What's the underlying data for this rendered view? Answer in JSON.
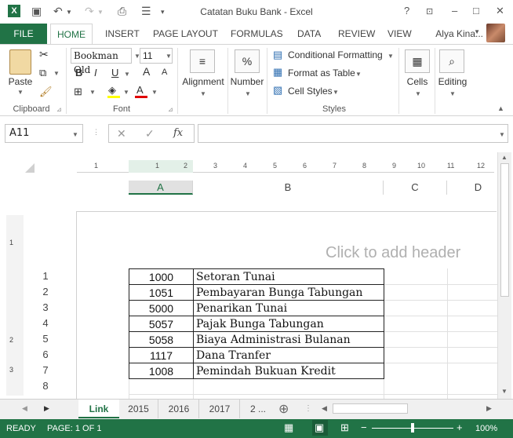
{
  "app": {
    "title": "Catatan Buku Bank - Excel",
    "brand_color": "#217346"
  },
  "window": {
    "help": "?",
    "minimize": "–",
    "maximize": "□",
    "close": "✕"
  },
  "quick_access": {
    "icons": [
      "excel-icon",
      "save-icon",
      "undo-icon",
      "redo-icon",
      "print-preview-icon",
      "customize-icon"
    ]
  },
  "ribbon_tabs": [
    "FILE",
    "HOME",
    "INSERT",
    "PAGE LAYOUT",
    "FORMULAS",
    "DATA",
    "REVIEW",
    "VIEW"
  ],
  "user": {
    "name": "Alya Kina..."
  },
  "ribbon": {
    "clipboard": {
      "paste": "Paste",
      "label": "Clipboard"
    },
    "font": {
      "name": "Bookman Old",
      "size": "11",
      "label": "Font",
      "bold": "B",
      "italic": "I",
      "underline": "U",
      "grow": "A",
      "shrink": "A"
    },
    "alignment": {
      "label": "Alignment",
      "icon": "≡"
    },
    "number": {
      "label": "Number",
      "icon": "%"
    },
    "styles": {
      "label": "Styles",
      "conditional": "Conditional Formatting",
      "format_table": "Format as Table",
      "cell_styles": "Cell Styles"
    },
    "cells": {
      "label": "Cells"
    },
    "editing": {
      "label": "Editing"
    }
  },
  "formula_bar": {
    "name_box": "A11",
    "cancel": "✕",
    "enter": "✓",
    "fx": "fx",
    "value": ""
  },
  "sheet": {
    "columns": [
      "A",
      "B",
      "C",
      "D"
    ],
    "header_hint": "Click to add header",
    "ruler_top": [
      "1",
      "1",
      "2",
      "3",
      "4",
      "5",
      "6",
      "7",
      "8",
      "9",
      "10",
      "11",
      "12"
    ],
    "ruler_left": [
      "1",
      "2",
      "3"
    ],
    "row_numbers": [
      "1",
      "2",
      "3",
      "4",
      "5",
      "6",
      "7",
      "8"
    ],
    "rows": [
      {
        "code": "1000",
        "desc": "Setoran Tunai"
      },
      {
        "code": "1051",
        "desc": "Pembayaran Bunga Tabungan"
      },
      {
        "code": "5000",
        "desc": "Penarikan Tunai"
      },
      {
        "code": "5057",
        "desc": "Pajak Bunga Tabungan"
      },
      {
        "code": "5058",
        "desc": "Biaya Administrasi Bulanan"
      },
      {
        "code": "1117",
        "desc": "Dana Tranfer"
      },
      {
        "code": "1008",
        "desc": "Pemindah Bukuan Kredit"
      }
    ]
  },
  "sheet_tabs": {
    "active": "Link",
    "others": [
      "2015",
      "2016",
      "2017",
      "2 ..."
    ],
    "add": "⊕"
  },
  "status": {
    "ready": "READY",
    "page": "PAGE: 1 OF 1",
    "zoom": "100%",
    "zoom_level": 1.0
  }
}
